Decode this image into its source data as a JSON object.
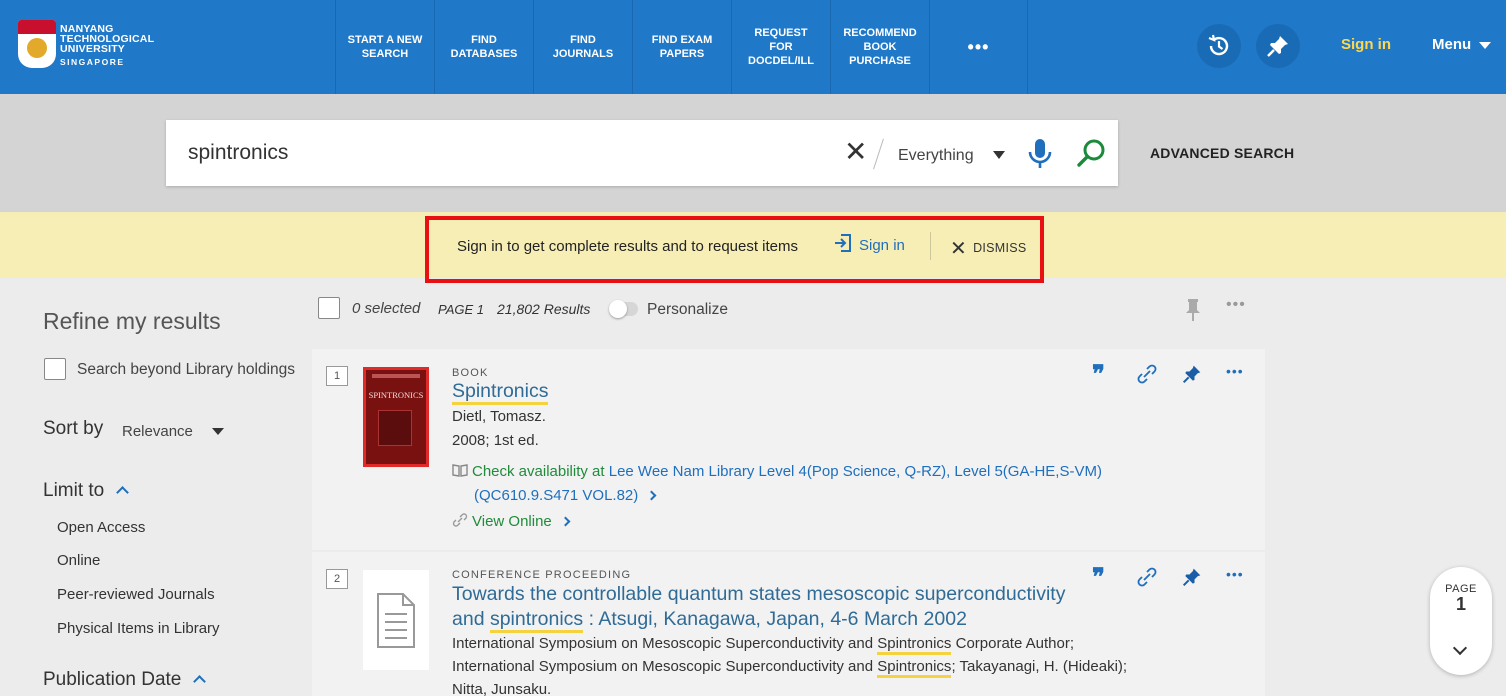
{
  "brand": {
    "line1": "NANYANG",
    "line2": "TECHNOLOGICAL",
    "line3": "UNIVERSITY",
    "line4": "SINGAPORE"
  },
  "nav": {
    "items": [
      {
        "label": "START A NEW SEARCH"
      },
      {
        "label": "FIND DATABASES"
      },
      {
        "label": "FIND JOURNALS"
      },
      {
        "label": "FIND EXAM PAPERS"
      },
      {
        "label": "REQUEST FOR DOCDEL/ILL"
      },
      {
        "label": "RECOMMEND BOOK PURCHASE"
      }
    ],
    "more": "•••",
    "sign_in": "Sign in",
    "menu": "Menu"
  },
  "search": {
    "query": "spintronics",
    "clear": "✕",
    "scope": "Everything",
    "advanced": "ADVANCED SEARCH"
  },
  "notice": {
    "message": "Sign in to get complete results and to request items",
    "sign_in": "Sign in",
    "dismiss": "DISMISS"
  },
  "facets": {
    "title": "Refine my results",
    "search_beyond": "Search beyond Library holdings",
    "sort_label": "Sort by",
    "sort_value": "Relevance",
    "limit_label": "Limit to",
    "limits": [
      "Open Access",
      "Online",
      "Peer-reviewed Journals",
      "Physical Items in Library"
    ],
    "pub_date": "Publication Date"
  },
  "results_header": {
    "selected": "0 selected",
    "page": "PAGE 1",
    "count": "21,802 Results",
    "personalize": "Personalize"
  },
  "results": [
    {
      "number": "1",
      "type": "BOOK",
      "title": "Spintronics",
      "author": "Dietl, Tomasz.",
      "edition": "2008; 1st ed.",
      "availability_prefix": "Check availability at",
      "availability_location": "Lee Wee Nam Library  Level 4(Pop Science, Q-RZ), Level 5(GA-HE,S-VM)",
      "availability_call": "(QC610.9.S471 VOL.82)",
      "online": "View Online",
      "cover_text": "SPINTRONICS"
    },
    {
      "number": "2",
      "type": "CONFERENCE PROCEEDING",
      "title_part1": "Towards the controllable quantum states mesoscopic superconductivity",
      "title_part2_pre": "and ",
      "title_part2_hl": "spintronics",
      "title_part2_post": " : Atsugi, Kanagawa, Japan, 4-6 March 2002",
      "line1_pre": "International Symposium on Mesoscopic Superconductivity and ",
      "line1_hl": "Spintronics",
      "line1_post": " Corporate Author;",
      "line2_pre": "International Symposium on Mesoscopic Superconductivity and ",
      "line2_hl": "Spintronics",
      "line2_post": "; Takayanagi, H. (Hideaki);",
      "line3": "Nitta, Junsaku."
    }
  ],
  "page_widget": {
    "label": "PAGE",
    "number": "1"
  }
}
